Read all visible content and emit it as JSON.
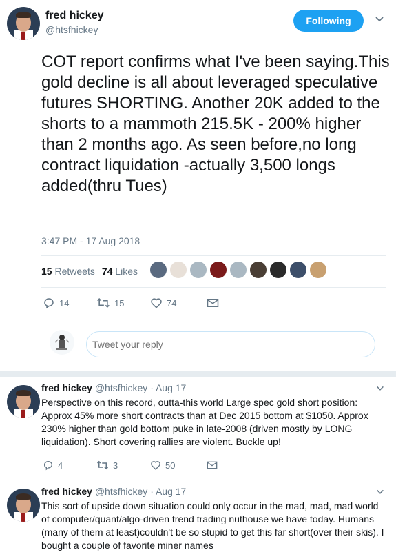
{
  "main": {
    "name": "fred hickey",
    "handle": "@htsfhickey",
    "follow_label": "Following",
    "text": "COT report confirms what I've been saying.This gold decline is all about leveraged speculative futures SHORTING. Another 20K added to the shorts to a mammoth 215.5K - 200% higher than 2 months ago. As seen before,no long contract liquidation -actually 3,500 longs added(thru Tues)",
    "timestamp": "3:47 PM - 17 Aug 2018",
    "retweets_count": "15",
    "retweets_label": "Retweets",
    "likes_count": "74",
    "likes_label": "Likes",
    "actions": {
      "replies": "14",
      "retweets": "15",
      "likes": "74"
    },
    "reply_placeholder": "Tweet your reply"
  },
  "replies": [
    {
      "name": "fred hickey",
      "handle": "@htsfhickey",
      "date": "· Aug 17",
      "text": "Perspective on this record, outta-this world Large spec gold short position: Approx 45% more short contracts than at Dec 2015 bottom at $1050. Approx 230% higher than gold bottom puke in late-2008 (driven mostly by LONG liquidation). Short covering rallies are violent. Buckle up!",
      "actions": {
        "replies": "4",
        "retweets": "3",
        "likes": "50"
      }
    },
    {
      "name": "fred hickey",
      "handle": "@htsfhickey",
      "date": "· Aug 17",
      "text": "This sort of upside down situation could only occur in the mad, mad, mad world of computer/quant/algo-driven trend trading nuthouse we have today. Humans (many of them at least)couldn't be so stupid to get this far short(over their skis). I bought a couple of favorite miner names"
    }
  ],
  "colors": {
    "accent": "#1da1f2",
    "muted": "#657786",
    "text": "#14171a",
    "divider": "#e6ecf0"
  },
  "icons": [
    "reply-icon",
    "retweet-icon",
    "heart-icon",
    "mail-icon",
    "chevron-down-icon"
  ]
}
